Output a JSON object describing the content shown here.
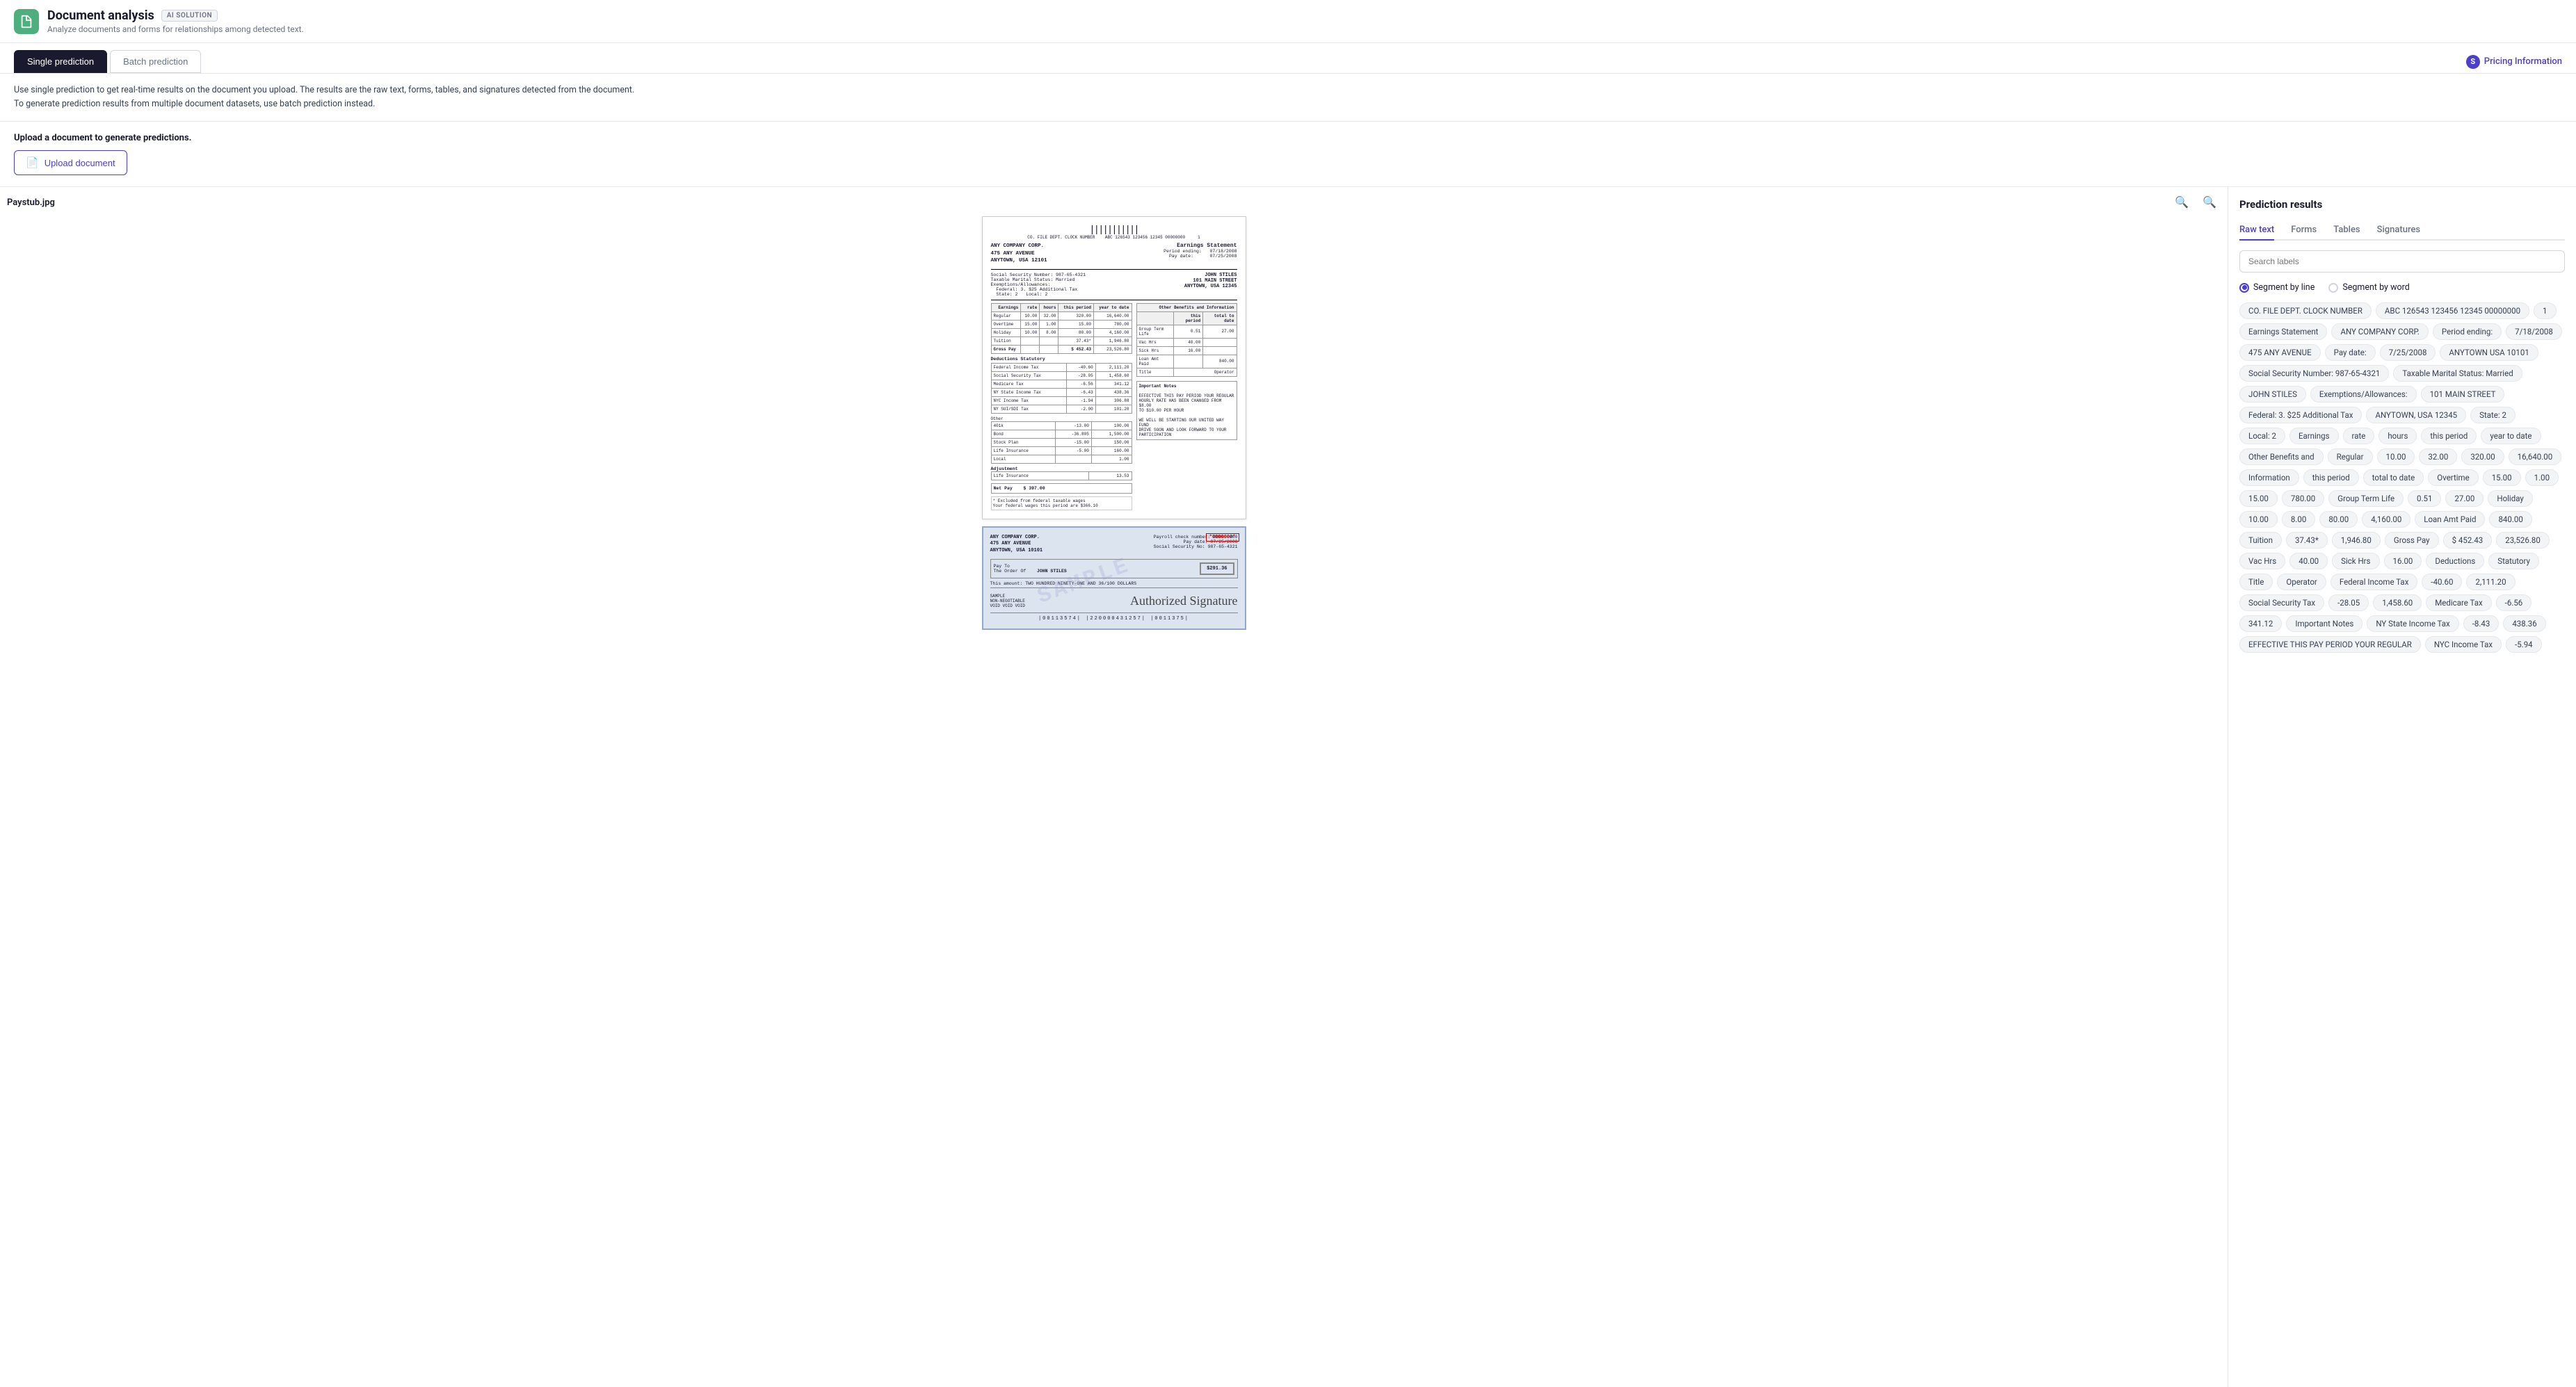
{
  "header": {
    "icon_alt": "document-icon",
    "title": "Document analysis",
    "badge": "AI SOLUTION",
    "subtitle": "Analyze documents and forms for relationships among detected text."
  },
  "tabs": {
    "left": [
      {
        "id": "single",
        "label": "Single prediction",
        "active": true
      },
      {
        "id": "batch",
        "label": "Batch prediction",
        "active": false
      }
    ],
    "pricing_label": "Pricing Information"
  },
  "description": {
    "line1": "Use single prediction to get real-time results on the document you upload. The results are the raw text, forms, tables, and signatures detected from the document.",
    "line2": "To generate prediction results from multiple document datasets, use batch prediction instead."
  },
  "upload": {
    "label": "Upload a document to generate predictions.",
    "button_label": "Upload document"
  },
  "document_viewer": {
    "filename": "Paystub.jpg"
  },
  "prediction": {
    "title": "Prediction results",
    "tabs": [
      {
        "id": "raw",
        "label": "Raw text",
        "active": true
      },
      {
        "id": "forms",
        "label": "Forms",
        "active": false
      },
      {
        "id": "tables",
        "label": "Tables",
        "active": false
      },
      {
        "id": "signatures",
        "label": "Signatures",
        "active": false
      }
    ],
    "search_placeholder": "Search labels",
    "segment_options": [
      {
        "id": "line",
        "label": "Segment by line",
        "selected": true
      },
      {
        "id": "word",
        "label": "Segment by word",
        "selected": false
      }
    ],
    "tags": [
      "CO. FILE DEPT. CLOCK NUMBER",
      "ABC 126543 123456 12345 00000000",
      "1",
      "Earnings Statement",
      "ANY COMPANY CORP.",
      "Period ending:",
      "7/18/2008",
      "475 ANY AVENUE",
      "Pay date:",
      "7/25/2008",
      "ANYTOWN USA 10101",
      "Social Security Number: 987-65-4321",
      "Taxable Marital Status: Married",
      "JOHN STILES",
      "Exemptions/Allowances:",
      "101 MAIN STREET",
      "Federal: 3. $25 Additional Tax",
      "ANYTOWN, USA 12345",
      "State: 2",
      "Local: 2",
      "Earnings",
      "rate",
      "hours",
      "this period",
      "year to date",
      "Other Benefits and",
      "Regular",
      "10.00",
      "32.00",
      "320.00",
      "16,640.00",
      "Information",
      "this period",
      "total to date",
      "Overtime",
      "15.00",
      "1.00",
      "15.00",
      "780.00",
      "Group Term Life",
      "0.51",
      "27.00",
      "Holiday",
      "10.00",
      "8.00",
      "80.00",
      "4,160.00",
      "Loan Amt Paid",
      "840.00",
      "Tuition",
      "37.43*",
      "1,946.80",
      "Gross Pay",
      "$ 452.43",
      "23,526.80",
      "Vac Hrs",
      "40.00",
      "Sick Hrs",
      "16.00",
      "Deductions",
      "Statutory",
      "Title",
      "Operator",
      "Federal Income Tax",
      "-40.60",
      "2,111.20",
      "Social Security Tax",
      "-28.05",
      "1,458.60",
      "Medicare Tax",
      "-6.56",
      "341.12",
      "Important Notes",
      "NY State Income Tax",
      "-8.43",
      "438.36",
      "EFFECTIVE THIS PAY PERIOD YOUR REGULAR",
      "NYC Income Tax",
      "-5.94"
    ]
  }
}
